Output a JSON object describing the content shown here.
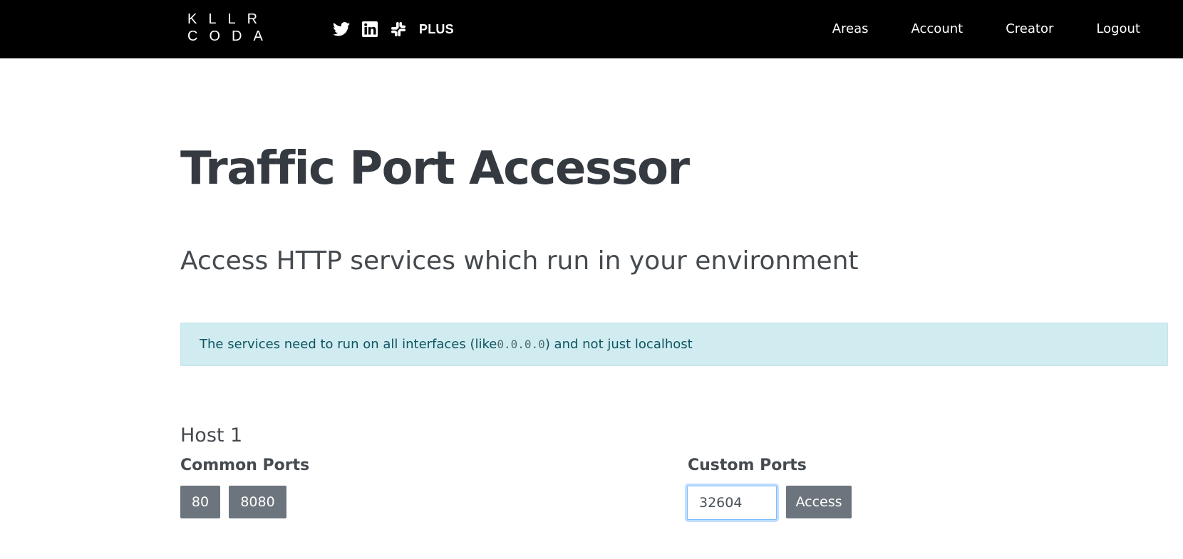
{
  "brand": {
    "logo_line1": "KLLR",
    "logo_line2": "CODA",
    "plus_label": "PLUS"
  },
  "social_icons": [
    "twitter-icon",
    "linkedin-icon",
    "slack-icon"
  ],
  "nav": {
    "areas": "Areas",
    "account": "Account",
    "creator": "Creator",
    "logout": "Logout"
  },
  "page": {
    "title": "Traffic Port Accessor",
    "subtitle": "Access HTTP services which run in your environment"
  },
  "alert": {
    "text_before": "The services need to run on all interfaces (like ",
    "code": "0.0.0.0",
    "text_after": ") and not just localhost"
  },
  "host": {
    "title": "Host 1",
    "common_ports_label": "Common Ports",
    "common_ports": [
      "80",
      "8080"
    ],
    "custom_ports_label": "Custom Ports",
    "custom_port_value": "32604",
    "access_label": "Access"
  },
  "colors": {
    "navbar_bg": "#000000",
    "alert_bg": "#d1ecf1",
    "alert_text": "#0c5460",
    "button_bg": "#6c757d"
  }
}
